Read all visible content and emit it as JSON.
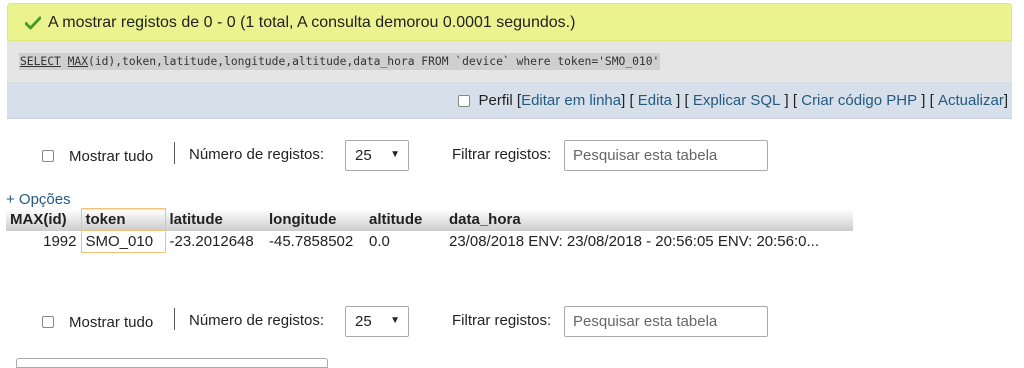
{
  "message": "A mostrar registos de 0 - 0 (1 total, A consulta demorou 0.0001 segundos.)",
  "sql": {
    "kw1": "SELECT",
    "fn": "MAX",
    "rest": "(id),token,latitude,longitude,altitude,data_hora FROM `device` where token='SMO_010'"
  },
  "tools": {
    "profiling": "Perfil",
    "edit_inline": "Editar em linha",
    "edit": "Edita",
    "explain": "Explicar SQL",
    "create_php": "Criar código PHP",
    "refresh": "Actualizar"
  },
  "nav": {
    "show_all": "Mostrar tudo",
    "num_rows_label": "Número de registos:",
    "num_rows_value": "25",
    "filter_label": "Filtrar registos:",
    "search_placeholder": "Pesquisar esta tabela"
  },
  "options_link": "+ Opções",
  "table": {
    "headers": [
      "MAX(id)",
      "token",
      "latitude",
      "longitude",
      "altitude",
      "data_hora"
    ],
    "rows": [
      [
        "1992",
        "SMO_010",
        "-23.2012648",
        "-45.7858502",
        "0.0",
        "23/08/2018 ENV: 23/08/2018 - 20:56:05 ENV: 20:56:0..."
      ]
    ]
  },
  "colors": {
    "success_bg": "#ebf38f",
    "sql_bg": "#e5e5e5",
    "toolbar_bg": "#d7e0ea",
    "link": "#235a81",
    "highlight_border": "#f0c27a"
  }
}
